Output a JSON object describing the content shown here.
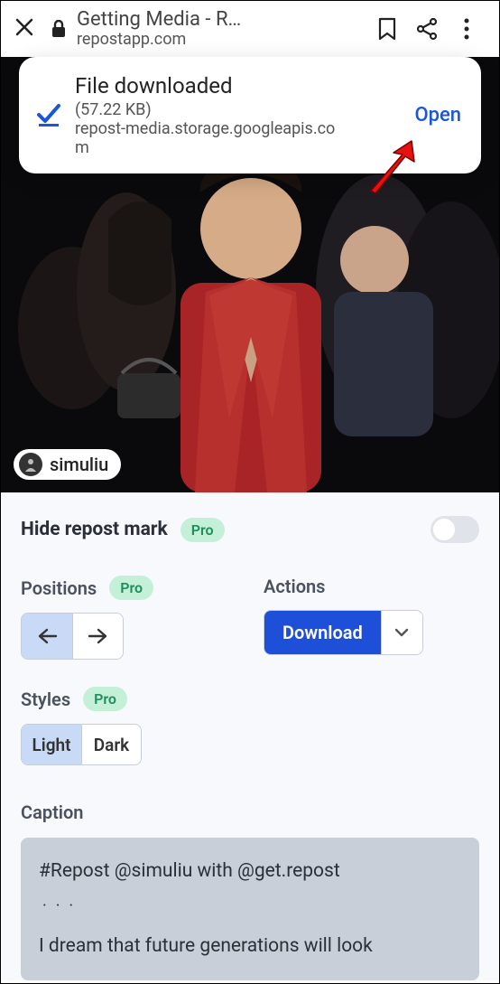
{
  "browser": {
    "title": "Getting Media - R…",
    "domain": "repostapp.com"
  },
  "notification": {
    "title": "File downloaded",
    "size": "(57.22 KB)",
    "url": "repost-media.storage.googleapis.com",
    "action": "Open"
  },
  "photo": {
    "username": "simuliu"
  },
  "controls": {
    "hide_label": "Hide repost mark",
    "pro": "Pro",
    "positions": {
      "label": "Positions"
    },
    "actions": {
      "label": "Actions",
      "download": "Download"
    },
    "styles": {
      "label": "Styles",
      "light": "Light",
      "dark": "Dark"
    },
    "caption": {
      "label": "Caption",
      "line1": "#Repost @simuliu with @get.repost",
      "dots": "···",
      "line2": "I dream that future generations will look"
    }
  }
}
